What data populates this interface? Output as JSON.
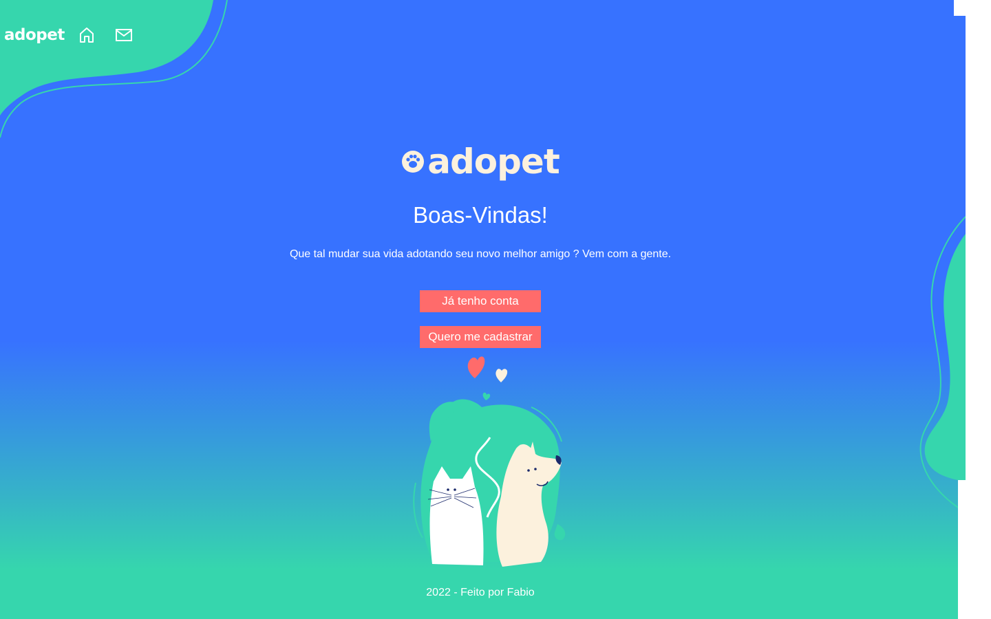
{
  "header": {
    "logo_text": "adopet",
    "nav": [
      {
        "icon": "home-icon",
        "label": "Home"
      },
      {
        "icon": "mail-icon",
        "label": "Mensagens"
      }
    ]
  },
  "hero": {
    "logo_text": "adopet",
    "title": "Boas-Vindas!",
    "subtitle": "Que tal mudar sua vida adotando seu novo melhor amigo ? Vem com a gente.",
    "buttons": {
      "login": "Já tenho conta",
      "signup": "Quero me cadastrar"
    }
  },
  "footer": {
    "text": "2022 - Feito por Fabio"
  },
  "colors": {
    "primary_blue": "#3772ff",
    "accent_green": "#36d6ad",
    "button_coral": "#ff6b6b",
    "logo_cream": "#fcf1dd"
  }
}
